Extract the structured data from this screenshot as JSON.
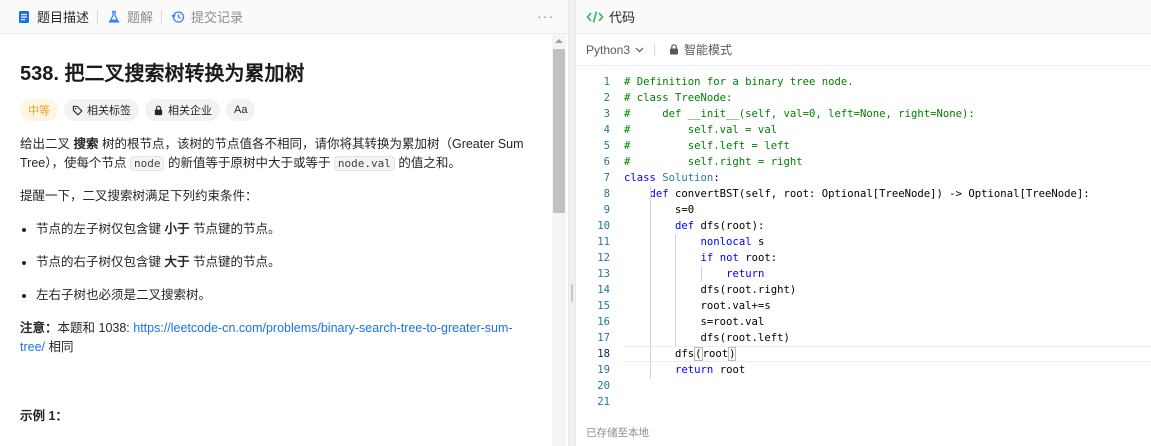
{
  "left": {
    "tabs": [
      {
        "label": "题目描述",
        "icon": "document-icon"
      },
      {
        "label": "题解",
        "icon": "flask-icon"
      },
      {
        "label": "提交记录",
        "icon": "history-icon"
      }
    ],
    "more_label": "···",
    "title": "538. 把二叉搜索树转换为累加树",
    "tags": {
      "difficulty": "中等",
      "related_tags": "相关标签",
      "related_companies": "相关企业",
      "font_size": "Aa"
    },
    "description": {
      "p1_a": "给出二叉 ",
      "p1_b": "搜索",
      "p1_c": " 树的根节点，该树的节点值各不相同，请你将其转换为累加树（Greater Sum Tree），使每个节点 ",
      "p1_code1": "node",
      "p1_d": " 的新值等于原树中大于或等于 ",
      "p1_code2": "node.val",
      "p1_e": " 的值之和。",
      "p2": "提醒一下，二叉搜索树满足下列约束条件：",
      "bullets": [
        {
          "a": "节点的左子树仅包含键 ",
          "b": "小于",
          "c": " 节点键的节点。"
        },
        {
          "a": "节点的右子树仅包含键 ",
          "b": "大于",
          "c": " 节点键的节点。"
        },
        {
          "a": "左右子树也必须是二叉搜索树。",
          "b": "",
          "c": ""
        }
      ],
      "note_label": "注意：",
      "note_text": "本题和 1038: ",
      "note_link": "https://leetcode-cn.com/problems/binary-search-tree-to-greater-sum-tree/",
      "note_tail": " 相同",
      "example_label": "示例 1："
    }
  },
  "right": {
    "header_title": "代码",
    "language": "Python3",
    "smart_mode": "智能模式",
    "footer_status": "已存储至本地",
    "code_lines": [
      "# Definition for a binary tree node.",
      "# class TreeNode:",
      "#     def __init__(self, val=0, left=None, right=None):",
      "#         self.val = val",
      "#         self.left = left",
      "#         self.right = right",
      "class Solution:",
      "    def convertBST(self, root: Optional[TreeNode]) -> Optional[TreeNode]:",
      "        s=0",
      "        def dfs(root):",
      "            nonlocal s",
      "            if not root:",
      "                return",
      "            dfs(root.right)",
      "            root.val+=s",
      "            s=root.val",
      "            dfs(root.left)",
      "        dfs(root)",
      "        return root",
      "",
      ""
    ],
    "current_line": 18
  },
  "colors": {
    "accent_green": "#2db55d",
    "difficulty": "#e8a32a",
    "link": "#1a73e8"
  }
}
